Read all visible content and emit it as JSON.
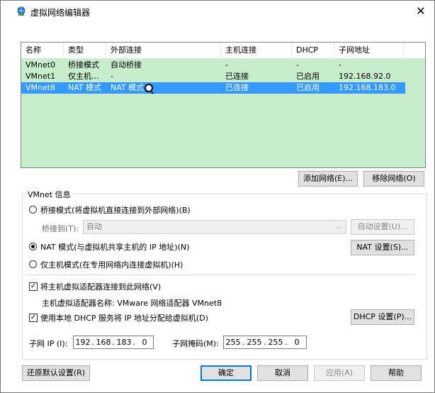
{
  "window": {
    "title": "虚拟网络编辑器",
    "close_glyph": "✕",
    "icon": "network-globe-icon"
  },
  "network_list": {
    "columns": [
      "名称",
      "类型",
      "外部连接",
      "主机连接",
      "DHCP",
      "子网地址"
    ],
    "rows": [
      {
        "name": "VMnet0",
        "type": "桥接模式",
        "external": "自动桥接",
        "host": "-",
        "dhcp": "-",
        "subnet": "-",
        "selected": false
      },
      {
        "name": "VMnet1",
        "type": "仅主机...",
        "external": "-",
        "host": "已连接",
        "dhcp": "已启用",
        "subnet": "192.168.92.0",
        "selected": false
      },
      {
        "name": "VMnet8",
        "type": "NAT 模式",
        "external": "NAT 模式",
        "host": "已连接",
        "dhcp": "已启用",
        "subnet": "192.168.183.0",
        "selected": true
      }
    ],
    "background_color": "#c7edcc",
    "selection_color": "#3399ff"
  },
  "list_buttons": {
    "add": "添加网络(E)...",
    "remove": "移除网络(O)"
  },
  "vmnet_info": {
    "group_label": "VMnet 信息",
    "bridge_radio": "桥接模式(将虚拟机直接连接到外部网络)(B)",
    "bridge_to_label": "桥接到(T):",
    "bridge_to_value": "自动",
    "auto_settings": "自动设置(U)...",
    "nat_radio": "NAT 模式(与虚拟机共享主机的 IP 地址)(N)",
    "nat_settings": "NAT 设置(S)...",
    "hostonly_radio": "仅主机模式(在专用网络内连接虚拟机)(H)",
    "selected_mode": "nat",
    "connect_adapter_check": "将主机虚拟适配器连接到此网络(V)",
    "connect_adapter_checked": true,
    "adapter_name_text": "主机虚拟适配器名称: VMware 网络适配器 VMnet8",
    "dhcp_check": "使用本地 DHCP 服务将 IP 地址分配给虚拟机(D)",
    "dhcp_checked": true,
    "dhcp_settings": "DHCP 设置(P)...",
    "subnet_ip_label": "子网 IP (I):",
    "subnet_ip": [
      "192",
      "168",
      "183",
      "0"
    ],
    "subnet_mask_label": "子网掩码(M):",
    "subnet_mask": [
      "255",
      "255",
      "255",
      "0"
    ]
  },
  "footer": {
    "restore_defaults": "还原默认设置(R)",
    "ok": "确定",
    "cancel": "取消",
    "apply": "应用(A)",
    "help": "帮助"
  },
  "check_glyph": "✓",
  "combo_arrow_glyph": "⌵"
}
